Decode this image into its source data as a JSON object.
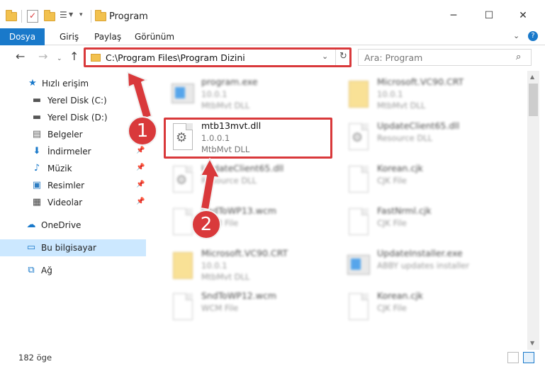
{
  "window": {
    "title": "Program"
  },
  "ribbon": {
    "tabs": [
      "Dosya",
      "Giriş",
      "Paylaş",
      "Görünüm"
    ]
  },
  "address": {
    "path": "C:\\Program Files\\Program Dizini"
  },
  "search": {
    "placeholder": "Ara: Program"
  },
  "nav": {
    "items": [
      {
        "label": "Hızlı erişim",
        "icon": "star-icon"
      },
      {
        "label": "Yerel Disk (C:)",
        "icon": "drive-icon"
      },
      {
        "label": "Yerel Disk (D:)",
        "icon": "drive-icon"
      },
      {
        "label": "Belgeler",
        "icon": "document-icon"
      },
      {
        "label": "İndirmeler",
        "icon": "download-icon"
      },
      {
        "label": "Müzik",
        "icon": "music-icon"
      },
      {
        "label": "Resimler",
        "icon": "pictures-icon"
      },
      {
        "label": "Videolar",
        "icon": "video-icon"
      },
      {
        "label": "OneDrive",
        "icon": "cloud-icon"
      },
      {
        "label": "Bu bilgisayar",
        "icon": "computer-icon"
      },
      {
        "label": "Ağ",
        "icon": "network-icon"
      }
    ]
  },
  "files": [
    {
      "name": "program.exe",
      "line1": "10.0.1",
      "line2": "MtbMvt DLL",
      "icon": "app-icon"
    },
    {
      "name": "Microsoft.VC90.CRT",
      "line1": "10.0.1",
      "line2": "MtbMvt DLL",
      "icon": "folder-icon"
    },
    {
      "name": "mtb13mvt.dll",
      "line1": "1.0.0.1",
      "line2": "MtbMvt DLL",
      "icon": "dll-gear-icon"
    },
    {
      "name": "UpdateClient65.dll",
      "line1": "Resource DLL",
      "line2": "",
      "icon": "dll-gear-icon"
    },
    {
      "name": "UpdateClient65.dll",
      "line1": "Resource DLL",
      "line2": "",
      "icon": "dll-gear-icon"
    },
    {
      "name": "Korean.cjk",
      "line1": "CJK File",
      "line2": "",
      "icon": "file-icon"
    },
    {
      "name": "SndToWP13.wcm",
      "line1": "WCM File",
      "line2": "",
      "icon": "file-icon"
    },
    {
      "name": "FastNrml.cjk",
      "line1": "CJK File",
      "line2": "",
      "icon": "file-icon"
    },
    {
      "name": "Microsoft.VC90.CRT",
      "line1": "10.0.1",
      "line2": "MtbMvt DLL",
      "icon": "folder-icon"
    },
    {
      "name": "UpdateInstaller.exe",
      "line1": "ABBY updates installer",
      "line2": "",
      "icon": "installer-icon"
    },
    {
      "name": "SndToWP12.wcm",
      "line1": "WCM File",
      "line2": "",
      "icon": "file-icon"
    },
    {
      "name": "Korean.cjk",
      "line1": "CJK File",
      "line2": "",
      "icon": "file-icon"
    }
  ],
  "annotations": {
    "step1": "1",
    "step2": "2"
  },
  "status": {
    "count": "182 öge"
  }
}
